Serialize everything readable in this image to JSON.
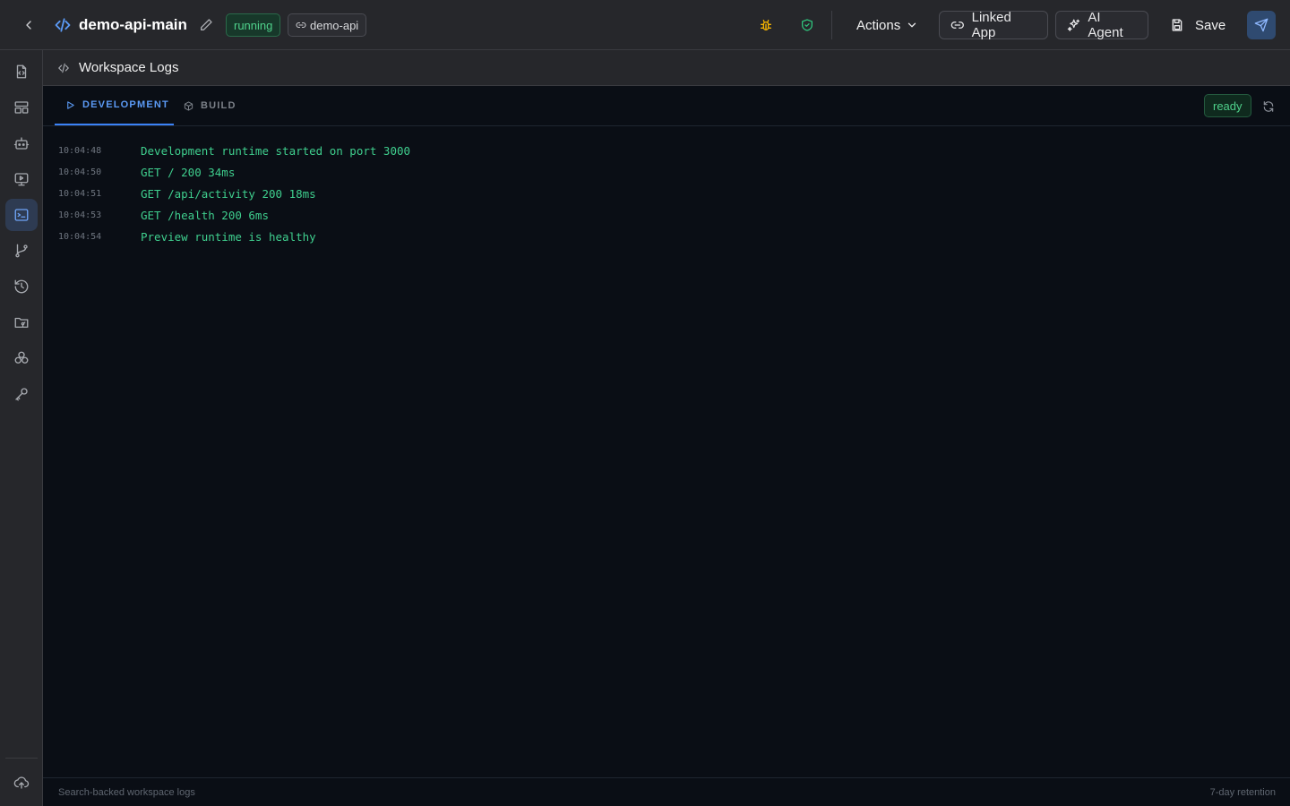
{
  "header": {
    "title": "demo-api-main",
    "status_badge": "running",
    "linked_badge": "demo-api",
    "actions_label": "Actions",
    "linked_app_label": "Linked App",
    "ai_agent_label": "AI Agent",
    "save_label": "Save"
  },
  "colors": {
    "accent": "#3b82f6",
    "success": "#4fd18b",
    "warning": "#f5b400",
    "log_text": "#3fcf8e"
  },
  "sidebar": {
    "items": [
      {
        "icon": "file-code-icon"
      },
      {
        "icon": "layout-icon"
      },
      {
        "icon": "bot-icon"
      },
      {
        "icon": "monitor-play-icon"
      },
      {
        "icon": "terminal-icon",
        "active": true
      },
      {
        "icon": "git-branch-icon"
      },
      {
        "icon": "history-icon"
      },
      {
        "icon": "folder-git-icon"
      },
      {
        "icon": "boxes-icon"
      },
      {
        "icon": "key-icon"
      }
    ],
    "bottom_icon": "cloud-upload-icon"
  },
  "panel": {
    "title": "Workspace Logs"
  },
  "tabs": {
    "development": "DEVELOPMENT",
    "build": "BUILD",
    "active": "development",
    "status": "ready"
  },
  "logs": [
    {
      "time": "10:04:48",
      "message": "Development runtime started on port 3000"
    },
    {
      "time": "10:04:50",
      "message": "GET / 200 34ms"
    },
    {
      "time": "10:04:51",
      "message": "GET /api/activity 200 18ms"
    },
    {
      "time": "10:04:53",
      "message": "GET /health 200 6ms"
    },
    {
      "time": "10:04:54",
      "message": "Preview runtime is healthy"
    }
  ],
  "footer": {
    "left": "Search-backed workspace logs",
    "right": "7-day retention"
  }
}
